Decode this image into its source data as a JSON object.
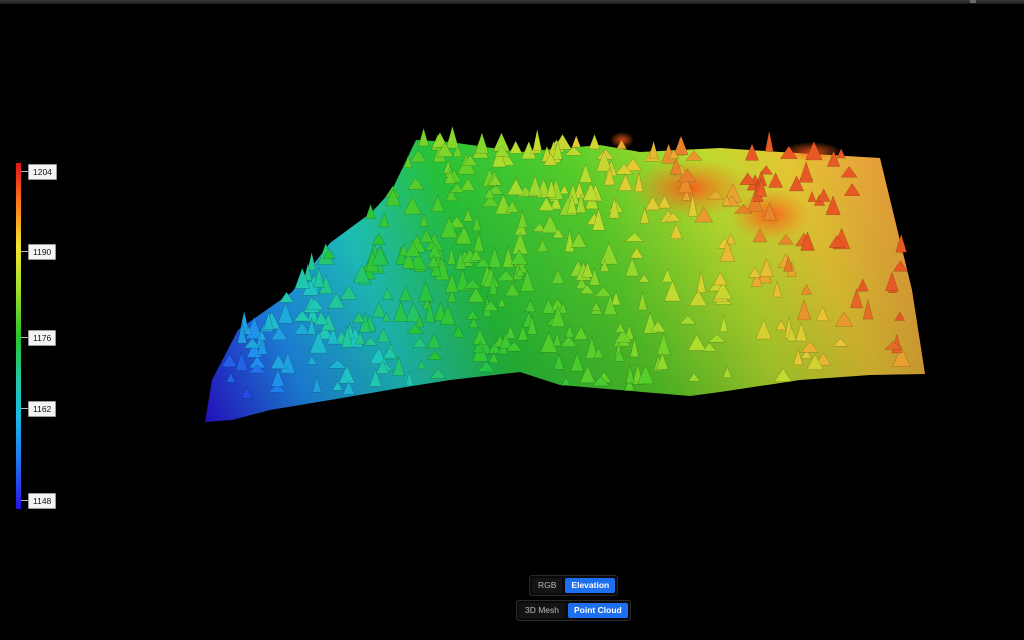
{
  "legend": {
    "labels": [
      "1204",
      "1190",
      "1176",
      "1162",
      "1148"
    ],
    "colors": {
      "top": "#e0141c",
      "upper": "#f3e531",
      "mid": "#29c42c",
      "lower": "#19bfe0",
      "bottom": "#2a12e8"
    }
  },
  "color_mode": {
    "options": [
      "RGB",
      "Elevation"
    ],
    "selected": "Elevation"
  },
  "render_mode": {
    "options": [
      "3D Mesh",
      "Point Cloud"
    ],
    "selected": "Point Cloud"
  },
  "accent_color": "#1e6ff0"
}
